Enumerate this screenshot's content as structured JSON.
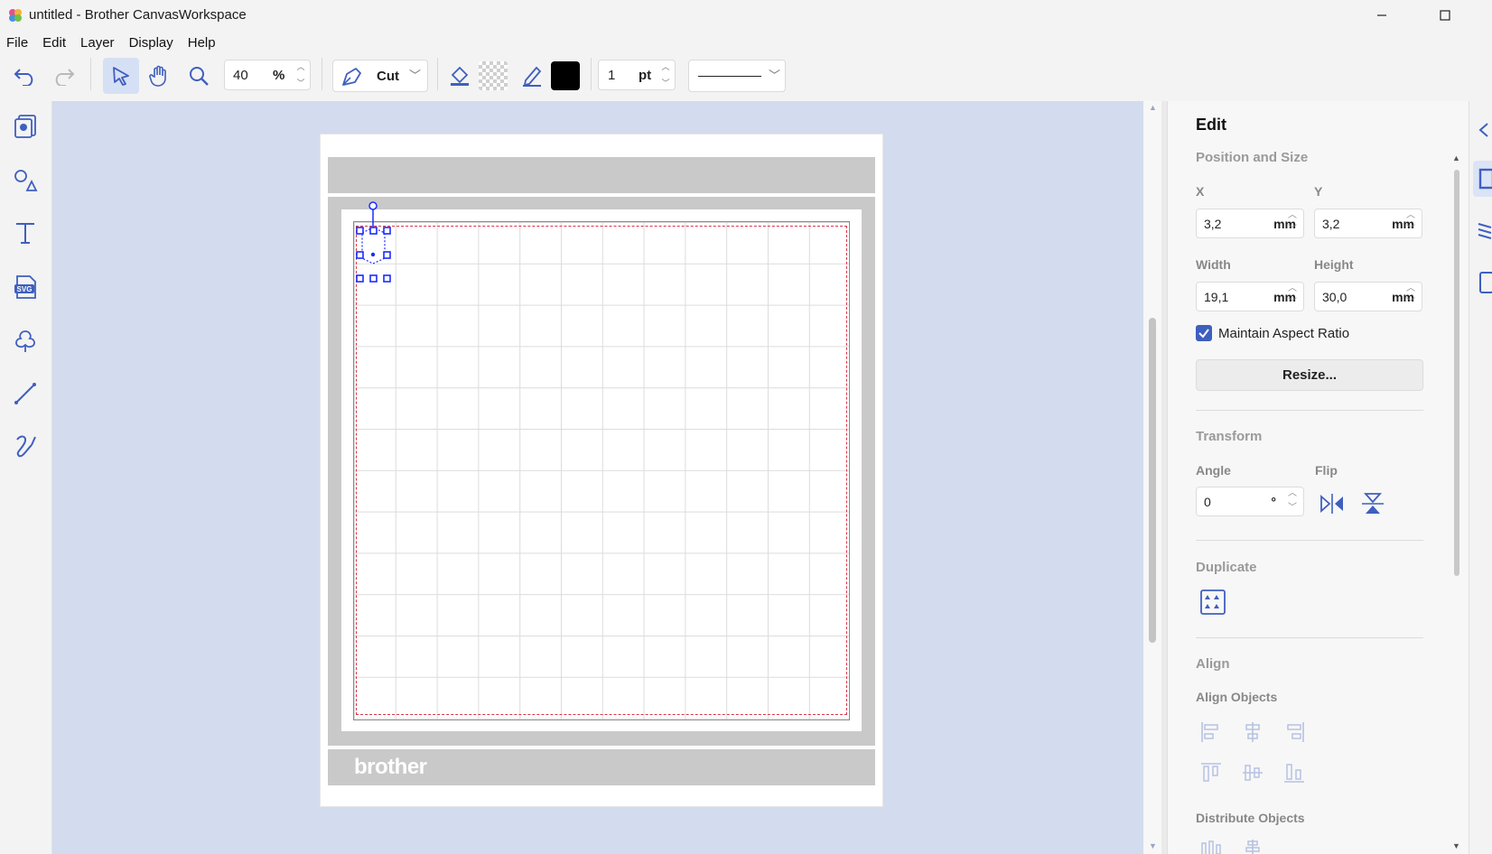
{
  "window": {
    "title": "untitled - Brother CanvasWorkspace",
    "minimize": "—",
    "maximize": "☐"
  },
  "menu": [
    "File",
    "Edit",
    "Layer",
    "Display",
    "Help"
  ],
  "toolbar": {
    "zoom_value": "40",
    "zoom_unit": "%",
    "mode_label": "Cut",
    "line_width_value": "1",
    "line_width_unit": "pt",
    "fill_color": "#000000",
    "accent": "#3f5fbf"
  },
  "canvas": {
    "brand": "brother"
  },
  "panel": {
    "title": "Edit",
    "position_size": {
      "heading": "Position and Size",
      "x_label": "X",
      "x_value": "3,2",
      "x_unit": "mm",
      "y_label": "Y",
      "y_value": "3,2",
      "y_unit": "mm",
      "width_label": "Width",
      "width_value": "19,1",
      "width_unit": "mm",
      "height_label": "Height",
      "height_value": "30,0",
      "height_unit": "mm",
      "aspect_label": "Maintain Aspect Ratio",
      "aspect_checked": true,
      "resize_label": "Resize..."
    },
    "transform": {
      "heading": "Transform",
      "angle_label": "Angle",
      "angle_value": "0",
      "angle_unit": "°",
      "flip_label": "Flip"
    },
    "duplicate": {
      "heading": "Duplicate"
    },
    "align": {
      "heading": "Align",
      "align_objects_label": "Align Objects",
      "distribute_label": "Distribute Objects"
    }
  }
}
